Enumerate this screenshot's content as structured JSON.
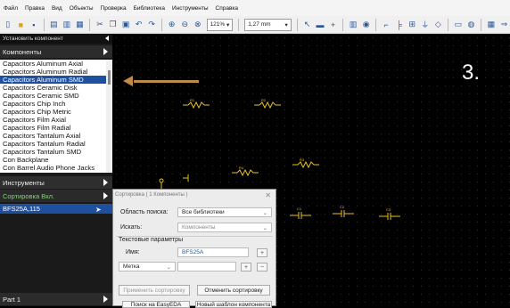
{
  "menu": [
    "Файл",
    "Правка",
    "Вид",
    "Объекты",
    "Проверка",
    "Библиотека",
    "Инструменты",
    "Справка"
  ],
  "toolbar": {
    "zoom": "121%",
    "grid": "1,27 mm"
  },
  "left_panel": {
    "header": "Установить компонент",
    "components_label": "Компоненты",
    "component_list": [
      "Capacitors Aluminum Axial",
      "Capacitors Aluminum Radial",
      "Capacitors Aluminum SMD",
      "Capacitors Ceramic Disk",
      "Capacitors Ceramic SMD",
      "Capacitors Chip Inch",
      "Capacitors Chip Metric",
      "Capacitors Film Axial",
      "Capacitors Film Radial",
      "Capacitors Tantalum Axial",
      "Capacitors Tantalum Radial",
      "Capacitors Tantalum SMD",
      "Con Backplane",
      "Con Barrel Audio Phone Jacks"
    ],
    "selected_index": 2,
    "tools_label": "Инструменты",
    "sort_label": "Сортировка Вкл.",
    "result_item": "BFS25A,115",
    "part_label": "Part 1"
  },
  "step_label": "3.",
  "dialog": {
    "title": "Сортировка ( 1 Компоненты )",
    "search_area_label": "Область поиска:",
    "search_area_value": "Все библиотеки",
    "search_label": "Искать:",
    "search_value": "Компоненты",
    "text_params_label": "Текстовые параметры",
    "name_label": "Имя:",
    "name_value": "BFS25A",
    "mark_label": "Метка",
    "apply_button": "Применить сортировку",
    "cancel_button": "Отменить сортировку",
    "bottom_left": "Поиск на EasyEDA",
    "bottom_right": "Новый шаблон компонента"
  },
  "canvas_labels": [
    "R1",
    "R2",
    "R3",
    "R4",
    "C1",
    "C2",
    "C3"
  ],
  "colors": {
    "accent": "#1e50a0",
    "arrow": "#c08b48",
    "component": "#e8c020"
  }
}
